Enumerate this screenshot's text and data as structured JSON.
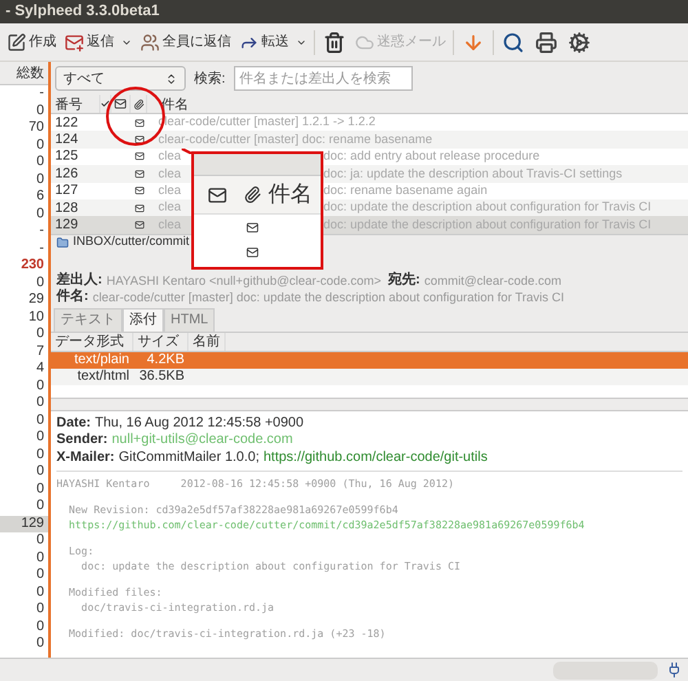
{
  "window": {
    "title": "- Sylpheed 3.3.0beta1"
  },
  "toolbar": [
    {
      "kind": "button",
      "label": "作成",
      "menu": false,
      "disabled": false
    },
    {
      "kind": "button",
      "label": "返信",
      "menu": true,
      "disabled": false
    },
    {
      "kind": "button",
      "label": "全員に返信",
      "menu": false,
      "disabled": false
    },
    {
      "kind": "button",
      "label": "転送",
      "menu": true,
      "disabled": false
    },
    {
      "kind": "icon",
      "disabled": false
    },
    {
      "kind": "button",
      "label": "迷惑メール",
      "menu": false,
      "disabled": true
    },
    {
      "kind": "icon",
      "disabled": false
    },
    {
      "kind": "icon",
      "disabled": false
    },
    {
      "kind": "icon",
      "disabled": false
    },
    {
      "kind": "icon",
      "disabled": false
    }
  ],
  "folder_counts": {
    "header": "総数",
    "rows": [
      {
        "value": "-",
        "selected": false,
        "highlighted": false
      },
      {
        "value": "0",
        "selected": false,
        "highlighted": false
      },
      {
        "value": "70",
        "selected": false,
        "highlighted": false
      },
      {
        "value": "0",
        "selected": false,
        "highlighted": false
      },
      {
        "value": "0",
        "selected": false,
        "highlighted": false
      },
      {
        "value": "0",
        "selected": false,
        "highlighted": false
      },
      {
        "value": "6",
        "selected": false,
        "highlighted": false
      },
      {
        "value": "0",
        "selected": false,
        "highlighted": false
      },
      {
        "value": "-",
        "selected": false,
        "highlighted": false
      },
      {
        "value": "-",
        "selected": false,
        "highlighted": false
      },
      {
        "value": "230",
        "selected": false,
        "highlighted": true
      },
      {
        "value": "0",
        "selected": false,
        "highlighted": false
      },
      {
        "value": "29",
        "selected": false,
        "highlighted": false
      },
      {
        "value": "10",
        "selected": false,
        "highlighted": false
      },
      {
        "value": "0",
        "selected": false,
        "highlighted": false
      },
      {
        "value": "7",
        "selected": false,
        "highlighted": false
      },
      {
        "value": "4",
        "selected": false,
        "highlighted": false
      },
      {
        "value": "0",
        "selected": false,
        "highlighted": false
      },
      {
        "value": "0",
        "selected": false,
        "highlighted": false
      },
      {
        "value": "0",
        "selected": false,
        "highlighted": false
      },
      {
        "value": "0",
        "selected": false,
        "highlighted": false
      },
      {
        "value": "0",
        "selected": false,
        "highlighted": false
      },
      {
        "value": "0",
        "selected": false,
        "highlighted": false
      },
      {
        "value": "0",
        "selected": false,
        "highlighted": false
      },
      {
        "value": "0",
        "selected": false,
        "highlighted": false
      },
      {
        "value": "129",
        "selected": true,
        "highlighted": false
      },
      {
        "value": "0",
        "selected": false,
        "highlighted": false
      },
      {
        "value": "0",
        "selected": false,
        "highlighted": false
      },
      {
        "value": "0",
        "selected": false,
        "highlighted": false
      },
      {
        "value": "0",
        "selected": false,
        "highlighted": false
      },
      {
        "value": "0",
        "selected": false,
        "highlighted": false
      },
      {
        "value": "0",
        "selected": false,
        "highlighted": false
      },
      {
        "value": "0",
        "selected": false,
        "highlighted": false
      }
    ]
  },
  "filter": {
    "value": "すべて"
  },
  "search": {
    "label": "検索:",
    "placeholder": "件名または差出人を検索"
  },
  "message_list": {
    "columns": {
      "number": "番号",
      "subject": "件名"
    },
    "rows": [
      {
        "number": "122",
        "subject": [
          "clear-code/cutter [master] 1.2.1 -> 1.2.2"
        ],
        "attachment": true,
        "selected": false
      },
      {
        "number": "124",
        "subject": [
          "clear-code/cutter [master] doc: rename basename"
        ],
        "attachment": true,
        "selected": false
      },
      {
        "number": "125",
        "subject": [
          "clea",
          "doc: add entry about release procedure"
        ],
        "attachment": true,
        "selected": false
      },
      {
        "number": "126",
        "subject": [
          "clea",
          "doc: ja: update the description about Travis-CI settings"
        ],
        "attachment": true,
        "selected": false
      },
      {
        "number": "127",
        "subject": [
          "clea",
          "doc: rename basename again"
        ],
        "attachment": true,
        "selected": false
      },
      {
        "number": "128",
        "subject": [
          "clea",
          "doc: update the description about configuration for Travis CI"
        ],
        "attachment": true,
        "selected": false
      },
      {
        "number": "129",
        "subject": [
          "clea",
          "doc: update the description about configuration for Travis CI"
        ],
        "attachment": true,
        "selected": true
      }
    ]
  },
  "folder_path": "INBOX/cutter/commit",
  "message_header": {
    "from_label": "差出人:",
    "from": "HAYASHI Kentaro <null+github@clear-code.com>",
    "to_label": "宛先:",
    "to": "commit@clear-code.com",
    "subject_label": "件名:",
    "subject": "clear-code/cutter [master] doc: update the description about configuration for Travis CI"
  },
  "tabs": [
    {
      "label": "テキスト",
      "selected": false
    },
    {
      "label": "添付",
      "selected": true
    },
    {
      "label": "HTML",
      "selected": false
    }
  ],
  "attachments": {
    "columns": [
      "データ形式",
      "サイズ",
      "名前"
    ],
    "rows": [
      {
        "type": "text/plain",
        "size": "4.2KB",
        "selected": true
      },
      {
        "type": "text/html",
        "size": "36.5KB",
        "selected": false
      }
    ]
  },
  "body": {
    "headers": [
      {
        "label": "Date:",
        "value": "Thu, 16 Aug 2012 12:45:58 +0900",
        "kind": "text"
      },
      {
        "label": "Sender:",
        "value": "null+git-utils@clear-code.com",
        "kind": "link"
      },
      {
        "label": "X-Mailer:",
        "value": "GitCommitMailer 1.0.0;",
        "link": "https://github.com/clear-code/git-utils",
        "kind": "mixed"
      }
    ],
    "paragraphs": [
      [
        {
          "text": "HAYASHI Kentaro     2012-08-16 12:45:58 +0900 (Thu, 16 Aug 2012)",
          "kind": "text"
        }
      ],
      [
        {
          "text": "  New Revision: cd39a2e5df57af38228ae981a69267e0599f6b4",
          "kind": "text"
        },
        {
          "text": "  https://github.com/clear-code/cutter/commit/cd39a2e5df57af38228ae981a69267e0599f6b4",
          "kind": "link"
        }
      ],
      [
        {
          "text": "  Log:",
          "kind": "text"
        },
        {
          "text": "    doc: update the description about configuration for Travis CI",
          "kind": "text"
        }
      ],
      [
        {
          "text": "  Modified files:",
          "kind": "text"
        },
        {
          "text": "    doc/travis-ci-integration.rd.ja",
          "kind": "text"
        }
      ],
      [
        {
          "text": "  Modified: doc/travis-ci-integration.rd.ja (+23 -18)",
          "kind": "text"
        }
      ]
    ]
  },
  "magnifier": {
    "header_label": "件名"
  }
}
